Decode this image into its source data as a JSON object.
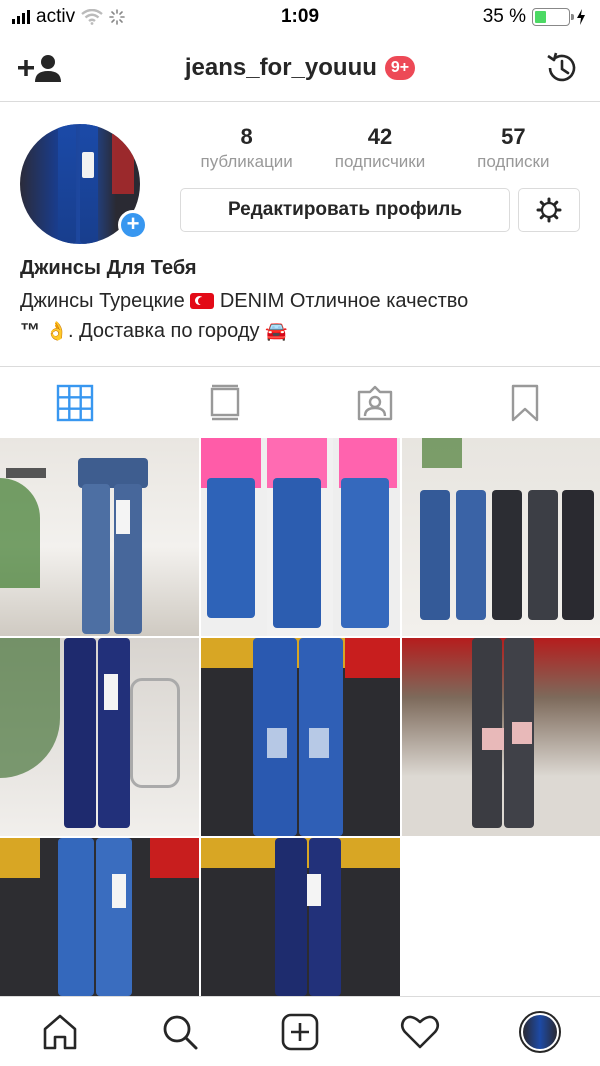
{
  "status_bar": {
    "carrier": "activ",
    "time": "1:09",
    "battery_percent": "35 %",
    "battery_level": 0.35
  },
  "header": {
    "username": "jeans_for_youuu",
    "notification_badge": "9+",
    "add_user_icon": "add-person-icon",
    "history_icon": "history-icon"
  },
  "profile": {
    "stats": [
      {
        "value": "8",
        "label": "публикации"
      },
      {
        "value": "42",
        "label": "подписчики"
      },
      {
        "value": "57",
        "label": "подписки"
      }
    ],
    "edit_button": "Редактировать профиль",
    "name": "Джинсы Для Тебя",
    "bio_part1": "Джинсы Турецкие",
    "bio_part2": "DENIM Отличное качество",
    "bio_tm": "™",
    "bio_part3": ". Доставка по городу",
    "ok_emoji": "👌",
    "car_emoji": "🚘"
  },
  "tabs": [
    {
      "name": "grid",
      "icon": "grid-icon",
      "active": true
    },
    {
      "name": "feed",
      "icon": "feed-icon",
      "active": false
    },
    {
      "name": "tagged",
      "icon": "tagged-person-icon",
      "active": false
    },
    {
      "name": "saved",
      "icon": "bookmark-icon",
      "active": false
    }
  ],
  "colors": {
    "accent": "#3897f0",
    "badge": "#ed4956",
    "border": "#dbdbdb",
    "muted_text": "#999999"
  },
  "bottom_nav": [
    "home-icon",
    "search-icon",
    "new-post-icon",
    "activity-heart-icon",
    "profile-avatar"
  ]
}
